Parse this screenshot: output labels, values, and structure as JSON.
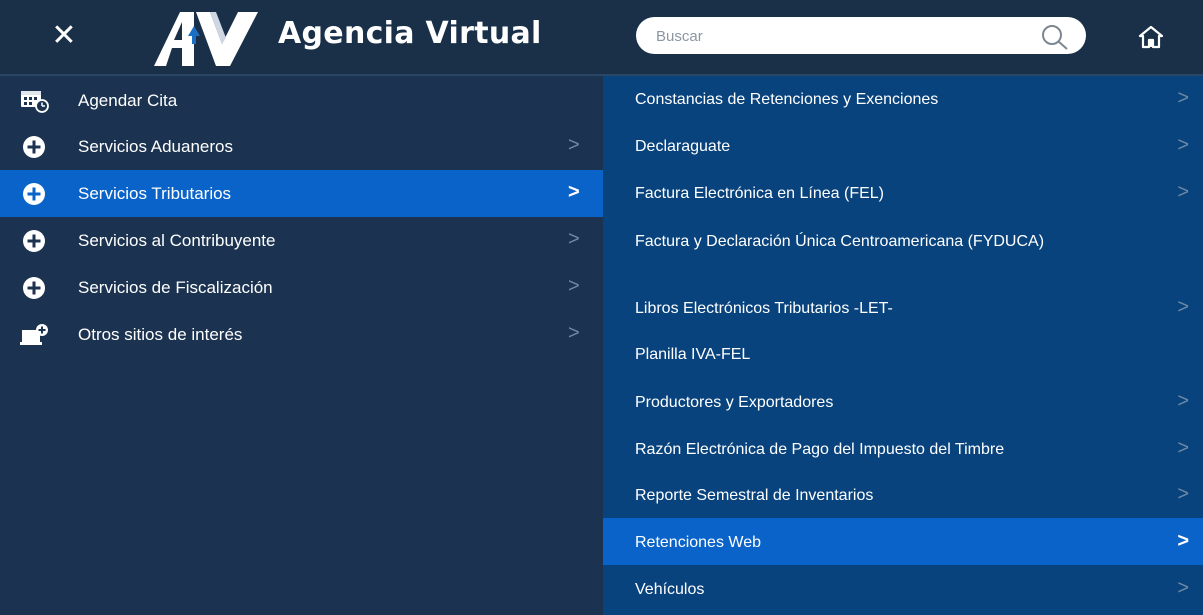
{
  "header": {
    "title": "Agencia Virtual",
    "search_placeholder": "Buscar",
    "close_glyph": "✕"
  },
  "left_menu": [
    {
      "label": "Agendar Cita",
      "icon": "calendar-clock-icon",
      "chevron": ""
    },
    {
      "label": "Servicios Aduaneros",
      "icon": "plus-circle-icon",
      "chevron": ">"
    },
    {
      "label": "Servicios Tributarios",
      "icon": "plus-circle-icon",
      "chevron": ">",
      "active": true
    },
    {
      "label": "Servicios al Contribuyente",
      "icon": "plus-circle-icon",
      "chevron": ">"
    },
    {
      "label": "Servicios de Fiscalización",
      "icon": "plus-circle-icon",
      "chevron": ">"
    },
    {
      "label": "Otros sitios de interés",
      "icon": "computer-plus-icon",
      "chevron": ">"
    }
  ],
  "right_menu": [
    {
      "label": "Constancias de Retenciones y Exenciones",
      "chevron": ">"
    },
    {
      "label": "Declaraguate",
      "chevron": ">"
    },
    {
      "label": "Factura Electrónica en Línea (FEL)",
      "chevron": ">"
    },
    {
      "label": "Factura y Declaración Única Centroamericana (FYDUCA)",
      "chevron": ""
    },
    {
      "label": "Libros Electrónicos Tributarios -LET-",
      "chevron": ">"
    },
    {
      "label": "Planilla IVA-FEL",
      "chevron": ""
    },
    {
      "label": "Productores y Exportadores",
      "chevron": ">"
    },
    {
      "label": "Razón Electrónica de Pago del Impuesto del Timbre",
      "chevron": ">"
    },
    {
      "label": "Reporte Semestral de Inventarios",
      "chevron": ">"
    },
    {
      "label": "Retenciones Web",
      "chevron": ">",
      "active": true
    },
    {
      "label": "Vehículos",
      "chevron": ">"
    }
  ],
  "colors": {
    "header_bg": "#1a3049",
    "left_bg": "#1b3350",
    "right_bg": "#08437d",
    "active_bg": "#0a63c9",
    "chevron": "#6f8aa8"
  }
}
